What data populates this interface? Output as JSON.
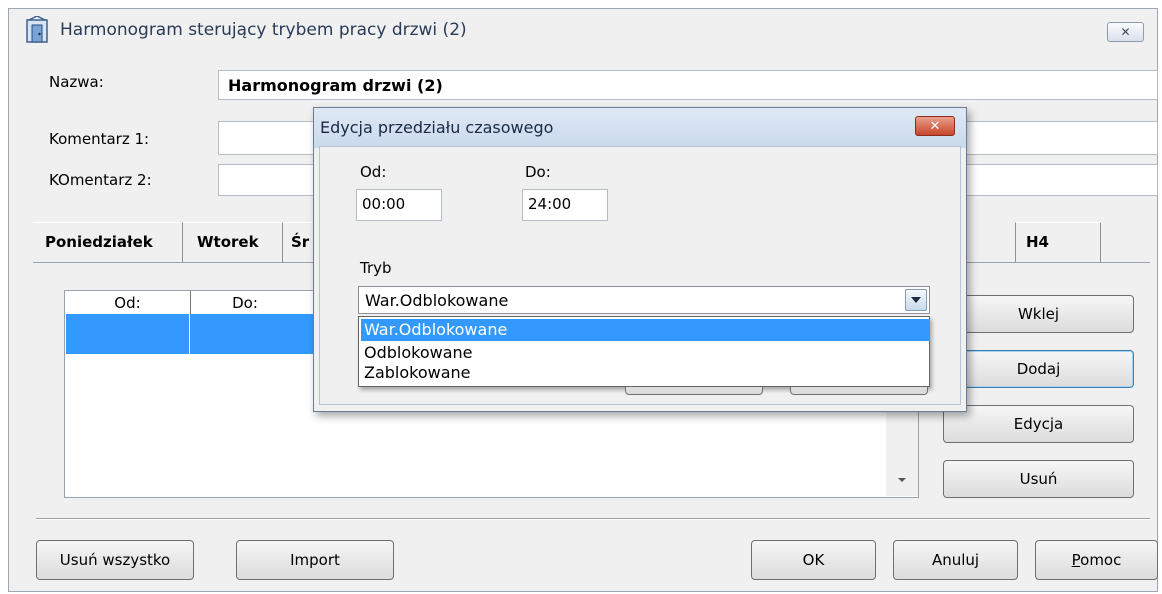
{
  "window": {
    "title": "Harmonogram sterujący trybem pracy drzwi (2)",
    "close_glyph": "✕"
  },
  "form": {
    "name_label": "Nazwa:",
    "name_value": "Harmonogram drzwi (2)",
    "comment1_label": "Komentarz 1:",
    "comment1_value": "",
    "comment2_label": "KOmentarz 2:",
    "comment2_value": ""
  },
  "tabs": [
    {
      "label": "Poniedziałek"
    },
    {
      "label": "Wtorek"
    },
    {
      "label": "Śr"
    },
    {
      "label": "H4"
    }
  ],
  "list": {
    "columns": [
      "Od:",
      "Do:"
    ],
    "rows": [
      {
        "od": "",
        "do": ""
      }
    ]
  },
  "side_buttons": {
    "paste": "Wklej",
    "add": "Dodaj",
    "edit": "Edycja",
    "delete": "Usuń"
  },
  "bottom_buttons": {
    "delete_all": "Usuń wszystko",
    "import": "Import",
    "ok": "OK",
    "cancel": "Anuluj",
    "help": "Pomoc",
    "help_rest": "omoc",
    "help_mnemonic": "P"
  },
  "dialog": {
    "title": "Edycja przedziału czasowego",
    "close_glyph": "✕",
    "from_label": "Od:",
    "from_value": "00:00",
    "to_label": "Do:",
    "to_value": "24:00",
    "mode_label": "Tryb",
    "mode_selected": "War.Odblokowane",
    "mode_options": [
      "War.Odblokowane",
      "Odblokowane",
      "Zablokowane"
    ]
  },
  "colors": {
    "selection": "#3399ff",
    "window_bg": "#f0f0f0",
    "dialog_title_bg": "#c9d9ec",
    "close_red": "#c8452a"
  }
}
